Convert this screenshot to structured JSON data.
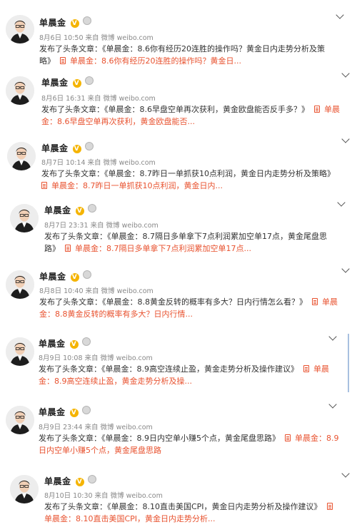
{
  "posts": [
    {
      "author": "单晨金",
      "time": "8月6日 10:50 来自",
      "source": "微博 weibo.com",
      "text": "发布了头条文章：《单晨金：8.6你有经历20连胜的操作吗？黄金日内走势分析及策略》",
      "link": "单晨金：8.6你有经历20连胜的操作吗？黄金日..."
    },
    {
      "author": "单晨金",
      "time": "8月6日 16:31 来自",
      "source": "微博 weibo.com",
      "text": "发布了头条文章：《单晨金：8.6早盘空单再次获利，黄金欧盘能否反手多？》",
      "link": "单晨金：8.6早盘空单再次获利，黄金欧盘能否..."
    },
    {
      "author": "单晨金",
      "time": "8月7日 10:14 来自",
      "source": "微博 weibo.com",
      "text": "发布了头条文章：《单晨金：8.7昨日一单抓获10点利润，黄金日内走势分析及策略》",
      "link": "单晨金：8.7昨日一单抓获10点利润，黄金日内..."
    },
    {
      "author": "单晨金",
      "time": "8月7日 23:31 来自",
      "source": "微博 weibo.com",
      "text": "发布了头条文章：《单晨金：8.7隔日多单拿下7点利润累加空单17点，黄金尾盘思路》",
      "link": "单晨金：8.7隔日多单拿下7点利润累加空单17点..."
    },
    {
      "author": "单晨金",
      "time": "8月8日 10:40 来自",
      "source": "微博 weibo.com",
      "text": "发布了头条文章：《单晨金：8.8黄金反转的概率有多大？日内行情怎么看？》",
      "link": "单晨金：8.8黄金反转的概率有多大？日内行情..."
    },
    {
      "author": "单晨金",
      "time": "8月9日 10:08 来自",
      "source": "微博 weibo.com",
      "text": "发布了头条文章：《单晨金：8.9高空连续止盈，黄金走势分析及操作建议》",
      "link": "单晨金：8.9高空连续止盈，黄金走势分析及操..."
    },
    {
      "author": "单晨金",
      "time": "8月9日 23:44 来自",
      "source": "微博 weibo.com",
      "text": "发布了头条文章：《单晨金：8.9日内空单小赚5个点，黄金尾盘思路》",
      "link": "单晨金：8.9日内空单小赚5个点，黄金尾盘思路"
    },
    {
      "author": "单晨金",
      "time": "8月10日 10:30 来自",
      "source": "微博 weibo.com",
      "text": "发布了头条文章：《单晨金：8.10直击美国CPI，黄金日内走势分析及操作建议》",
      "link": "单晨金：8.10直击美国CPI，黄金日内走势分析..."
    }
  ],
  "verified_badge": "V",
  "colors": {
    "link": "#e8522f",
    "meta": "#888888",
    "badge": "#f5b400"
  },
  "icons": {
    "chevron": "chevron-down-icon",
    "doc": "article-icon",
    "medal": "medal-icon"
  }
}
